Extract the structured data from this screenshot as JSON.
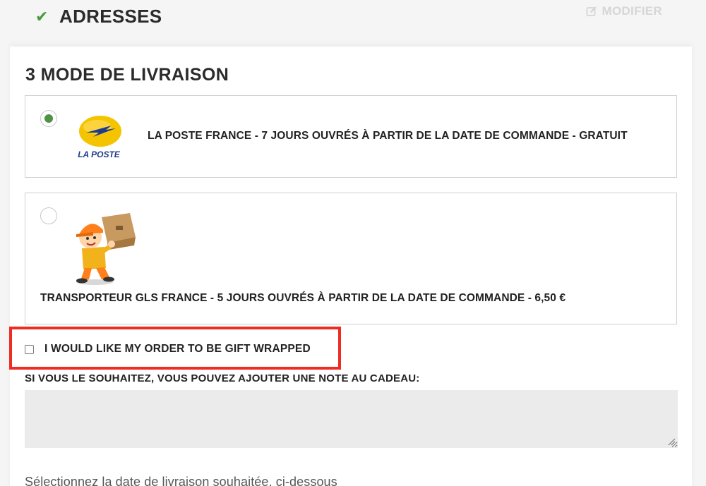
{
  "steps": {
    "addresses": {
      "check_glyph": "✔",
      "title": "ADRESSES",
      "edit_label": "MODIFIER"
    },
    "delivery": {
      "title": "3 MODE DE LIVRAISON",
      "carriers": [
        {
          "name": "LA POSTE FRANCE - 7 JOURS OUVRÉS À PARTIR DE LA DATE DE COMMANDE - GRATUIT",
          "logo_text": "LA POSTE",
          "selected": true
        },
        {
          "name": "TRANSPORTEUR GLS FRANCE - 5 JOURS OUVRÉS À PARTIR DE LA DATE DE COMMANDE - 6,50 €",
          "selected": false
        }
      ],
      "gift": {
        "label": "I WOULD LIKE MY ORDER TO BE GIFT WRAPPED",
        "checked": false
      },
      "note_label": "SI VOUS LE SOUHAITEZ, VOUS POUVEZ AJOUTER UNE NOTE AU CADEAU:",
      "note_value": "",
      "date_prompt": "Sélectionnez la date de livraison souhaitée, ci-dessous"
    }
  },
  "colors": {
    "check": "#4a9a3b",
    "radio_selected": "#4f9244",
    "highlight": "#ee2c24",
    "laposte_yellow": "#f5c400",
    "laposte_blue": "#1e3b8c"
  },
  "icons": {
    "check": "check-icon",
    "edit": "edit-icon",
    "laposte": "laposte-logo",
    "gls": "delivery-man-illustration"
  }
}
